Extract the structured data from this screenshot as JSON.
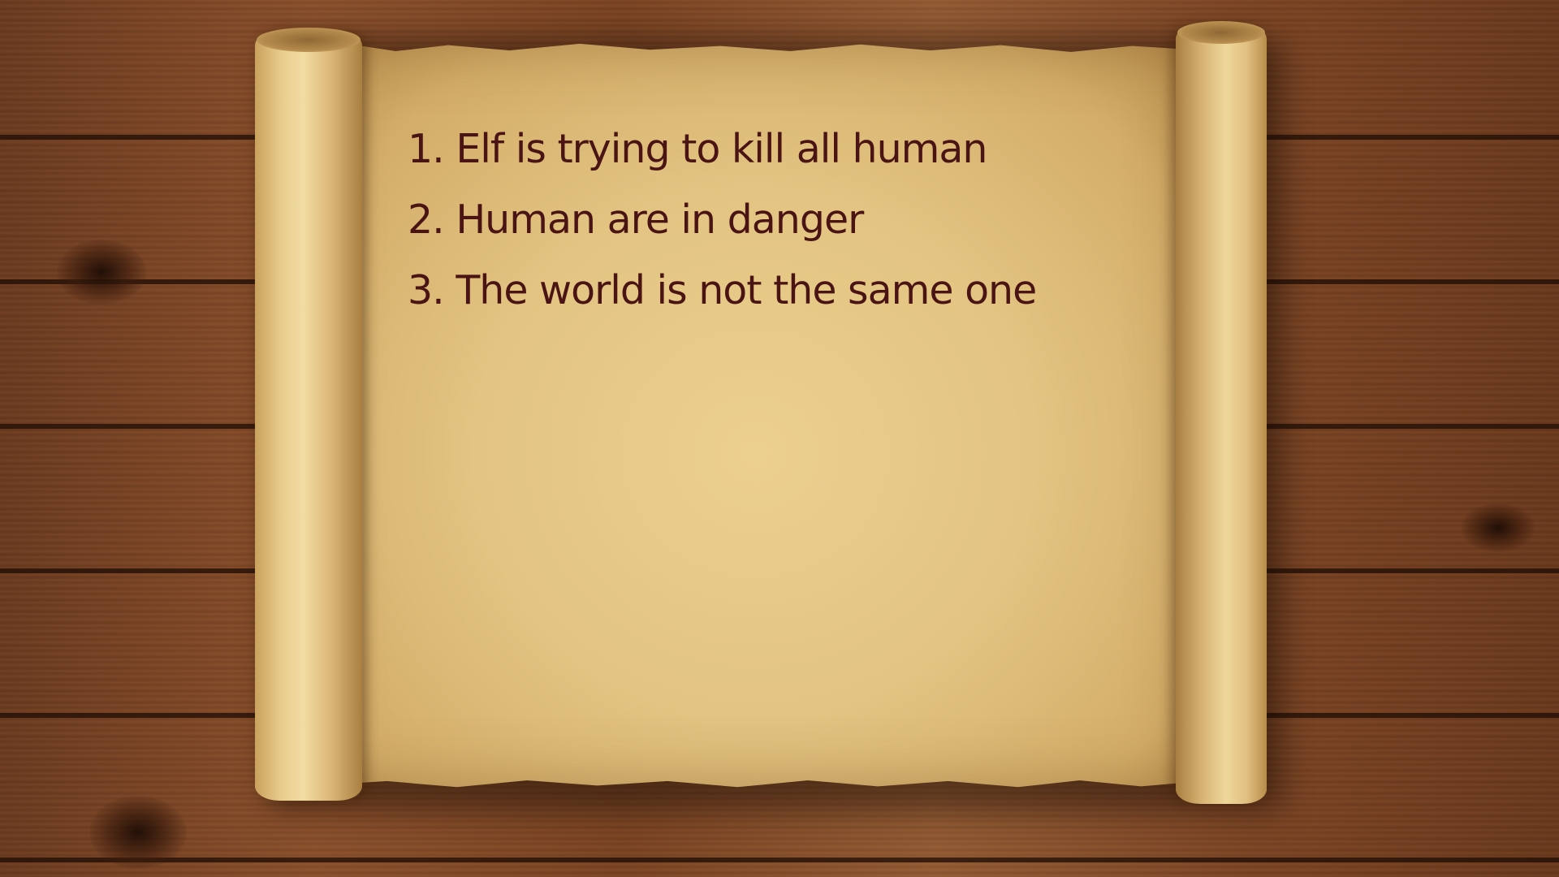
{
  "notes": {
    "items": [
      "1. Elf is trying to kill all human",
      "2. Human are in danger",
      "3. The world is not the same one"
    ]
  },
  "colors": {
    "text": "#4a1414",
    "paper": "#e3c482",
    "wood": "#7a4322"
  }
}
